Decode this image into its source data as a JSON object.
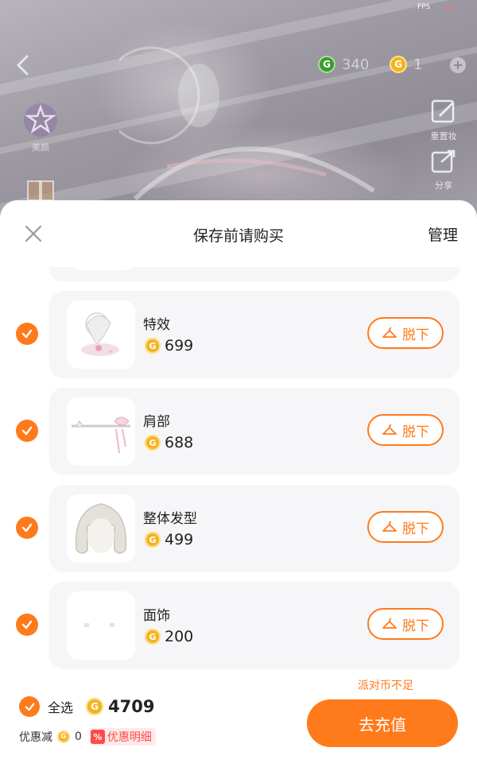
{
  "status": {
    "fps_label": "FPS",
    "fps_value": "16"
  },
  "top_bar": {
    "currencies": [
      {
        "icon": "g-coin-icon",
        "value": "340"
      },
      {
        "icon": "party-coin-icon",
        "value": "1"
      }
    ]
  },
  "side_left": [
    {
      "icon": "star-badge-icon",
      "label": "美颜"
    },
    {
      "icon": "gift-icon",
      "label": ""
    }
  ],
  "side_right": [
    {
      "icon": "edit-icon",
      "label": "重置妆"
    },
    {
      "icon": "share-icon",
      "label": "分享"
    }
  ],
  "sheet": {
    "title": "保存前请购买",
    "manage_label": "管理",
    "items": [
      {
        "name": "特效",
        "price": "699",
        "action": "脱下",
        "checked": true,
        "thumb": "effect"
      },
      {
        "name": "肩部",
        "price": "688",
        "action": "脱下",
        "checked": true,
        "thumb": "shoulder"
      },
      {
        "name": "整体发型",
        "price": "499",
        "action": "脱下",
        "checked": true,
        "thumb": "hair"
      },
      {
        "name": "面饰",
        "price": "200",
        "action": "脱下",
        "checked": true,
        "thumb": "face"
      }
    ]
  },
  "footer": {
    "insufficient_text": "派对币不足",
    "select_all_label": "全选",
    "total": "4709",
    "discount_label": "优惠减",
    "discount_value": "0",
    "promo_label": "优惠明细",
    "recharge_label": "去充值"
  },
  "colors": {
    "accent": "#ff7a1a",
    "promo": "#ff4a4a",
    "coin": "#f3b323",
    "card_bg": "#f6f6f8"
  }
}
